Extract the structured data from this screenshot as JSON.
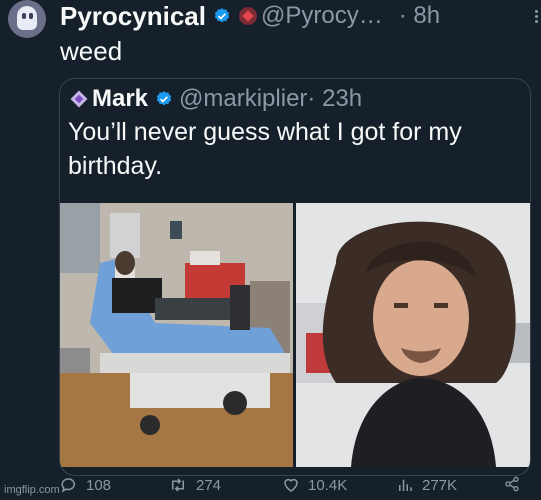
{
  "tweet": {
    "author_name": "Pyrocynical",
    "author_handle": "@Pyrocy…",
    "time": "· 8h",
    "text": "weed"
  },
  "quoted": {
    "author_name": "Mark",
    "author_handle": "@markiplier",
    "time": "· 23h",
    "text": "You’ll never guess what I got for my birthday."
  },
  "stats": {
    "replies": "108",
    "retweets": "274",
    "likes": "10.4K",
    "views": "277K"
  },
  "watermark": "imgflip.com",
  "icons": {
    "verified": "verified-badge-icon",
    "reply": "reply-icon",
    "retweet": "retweet-icon",
    "like": "heart-icon",
    "views": "views-icon",
    "share": "share-icon",
    "more": "more-options-icon"
  },
  "colors": {
    "background": "#15202b",
    "text": "#f7f9f9",
    "secondary": "#8b98a5",
    "verified": "#1d9bf0",
    "border": "#38444d"
  }
}
